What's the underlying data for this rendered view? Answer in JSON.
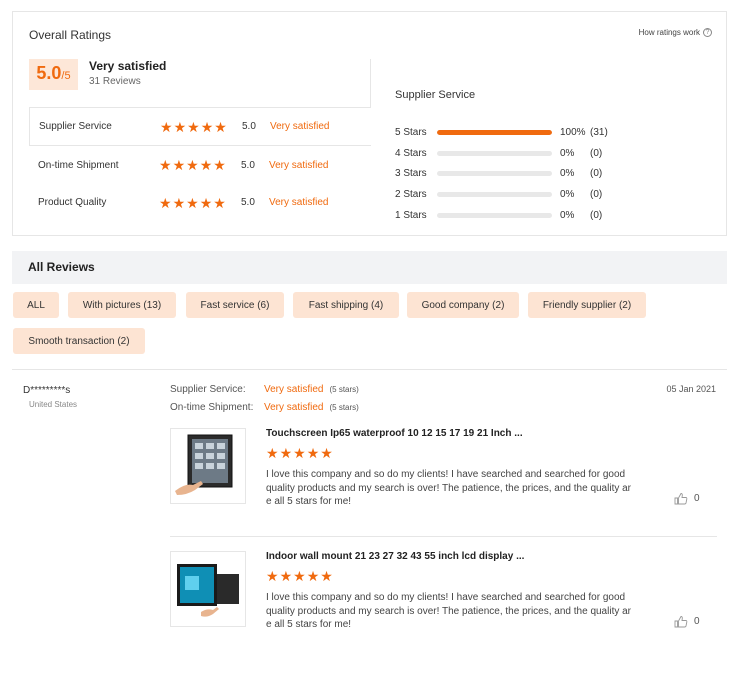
{
  "overall": {
    "title": "Overall Ratings",
    "how_link": "How ratings work",
    "score": "5.0",
    "score_suffix": "/5",
    "satisfaction": "Very satisfied",
    "review_count": "31 Reviews",
    "categories": [
      {
        "label": "Supplier Service",
        "stars": 5,
        "value": "5.0",
        "word": "Very satisfied"
      },
      {
        "label": "On-time Shipment",
        "stars": 5,
        "value": "5.0",
        "word": "Very satisfied"
      },
      {
        "label": "Product Quality",
        "stars": 5,
        "value": "5.0",
        "word": "Very satisfied"
      }
    ]
  },
  "supplier_service": {
    "title": "Supplier Service",
    "distribution": [
      {
        "label": "5  Stars",
        "fraction": 1.0,
        "pct": "100%",
        "count": "(31)"
      },
      {
        "label": "4  Stars",
        "fraction": 0,
        "pct": "0%",
        "count": "(0)"
      },
      {
        "label": "3  Stars",
        "fraction": 0,
        "pct": "0%",
        "count": "(0)"
      },
      {
        "label": "2  Stars",
        "fraction": 0,
        "pct": "0%",
        "count": "(0)"
      },
      {
        "label": "1  Stars",
        "fraction": 0,
        "pct": "0%",
        "count": "(0)"
      }
    ]
  },
  "reviews": {
    "title": "All Reviews",
    "filters": [
      "ALL",
      "With pictures (13)",
      "Fast service (6)",
      "Fast shipping (4)",
      "Good company (2)",
      "Friendly supplier (2)",
      "Smooth transaction (2)"
    ],
    "items": [
      {
        "reviewer": "D*********s",
        "country": "United States",
        "date": "05 Jan 2021",
        "ratings": [
          {
            "key": "Supplier Service:",
            "value": "Very satisfied",
            "note": "(5 stars)"
          },
          {
            "key": "On-time Shipment:",
            "value": "Very satisfied",
            "note": "(5 stars)"
          }
        ],
        "products": [
          {
            "title": "Touchscreen Ip65 waterproof 10 12 15 17 19 21 Inch ...",
            "stars": 5,
            "text": "I love this company and so do my clients! I have searched and searched for good quality products and my search is over! The patience, the prices, and the quality ar e all 5 stars for me!",
            "likes": "0"
          },
          {
            "title": "Indoor wall mount 21 23 27 32 43 55 inch lcd display ...",
            "stars": 5,
            "text": "I love this company and so do my clients! I have searched and searched for good quality products and my search is over! The patience, the prices, and the quality ar e all 5 stars for me!",
            "likes": "0"
          }
        ]
      }
    ]
  },
  "colors": {
    "accent": "#f06a0f",
    "chip_bg": "#fde4d3",
    "badge_bg": "#fde7d8"
  }
}
